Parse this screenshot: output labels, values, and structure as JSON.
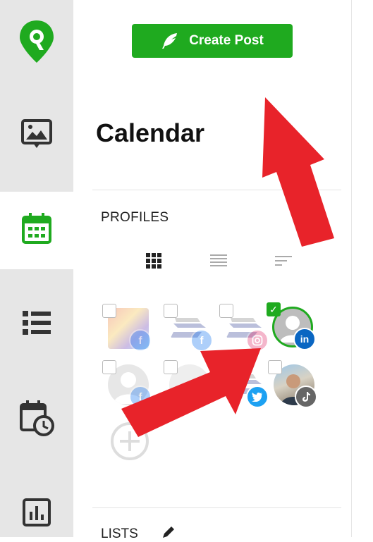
{
  "nav": {
    "items": [
      {
        "name": "logo",
        "icon": "map-pin-logo-icon"
      },
      {
        "name": "media",
        "icon": "image-chat-icon"
      },
      {
        "name": "calendar",
        "icon": "calendar-icon",
        "active": true
      },
      {
        "name": "list",
        "icon": "list-icon"
      },
      {
        "name": "schedule",
        "icon": "calendar-clock-icon"
      },
      {
        "name": "analytics",
        "icon": "bar-chart-icon"
      }
    ],
    "accent_color": "#1faa1f"
  },
  "create_post": {
    "label": "Create Post",
    "icon": "feather-icon"
  },
  "page": {
    "title": "Calendar"
  },
  "profiles": {
    "label": "PROFILES",
    "views": [
      "grid-view-icon",
      "list-view-icon",
      "sort-view-icon"
    ],
    "items": [
      {
        "network": "facebook",
        "badge_color": "#1877f2",
        "checked": false
      },
      {
        "network": "facebook",
        "badge_color": "#1877f2",
        "checked": false
      },
      {
        "network": "instagram",
        "badge_color": "#e1306c",
        "checked": false
      },
      {
        "network": "linkedin",
        "badge_color": "#0a66c2",
        "checked": true
      },
      {
        "network": "facebook",
        "badge_color": "#1877f2",
        "checked": false
      },
      {
        "network": "unknown",
        "badge_color": "#888888",
        "checked": false
      },
      {
        "network": "twitter",
        "badge_color": "#1da1f2",
        "checked": false
      },
      {
        "network": "tiktok",
        "badge_color": "#666666",
        "checked": false
      }
    ]
  },
  "lists": {
    "label": "LISTS"
  }
}
